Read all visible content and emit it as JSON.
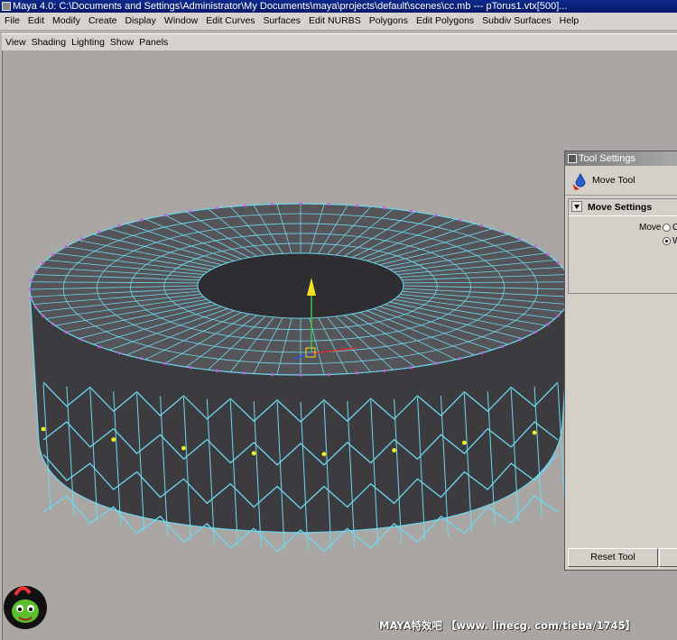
{
  "window": {
    "title": "Maya 4.0: C:\\Documents and Settings\\Administrator\\My Documents\\maya\\projects\\default\\scenes\\cc.mb  ---   pTorus1.vtx[500]..."
  },
  "main_menu": [
    "File",
    "Edit",
    "Modify",
    "Create",
    "Display",
    "Window",
    "Edit Curves",
    "Surfaces",
    "Edit NURBS",
    "Polygons",
    "Edit Polygons",
    "Subdiv Surfaces",
    "Help"
  ],
  "panel_menu": [
    "View",
    "Shading",
    "Lighting",
    "Show",
    "Panels"
  ],
  "tool_settings": {
    "title": "Tool Settings",
    "tool_name": "Move Tool",
    "section": "Move Settings",
    "move_label": "Move",
    "options": [
      {
        "label": "Ol",
        "selected": false
      },
      {
        "label": "W",
        "selected": true
      }
    ],
    "reset_label": "Reset Tool"
  },
  "watermark": "MAYA特效吧 【www. linecg. com/tieba/1745】",
  "colors": {
    "wireframe": "#6fd8ee",
    "vertex": "#c060e0",
    "selected_vertex": "#f0f020",
    "viewport_bg": "#a9a6a3",
    "mesh": "#444448"
  }
}
